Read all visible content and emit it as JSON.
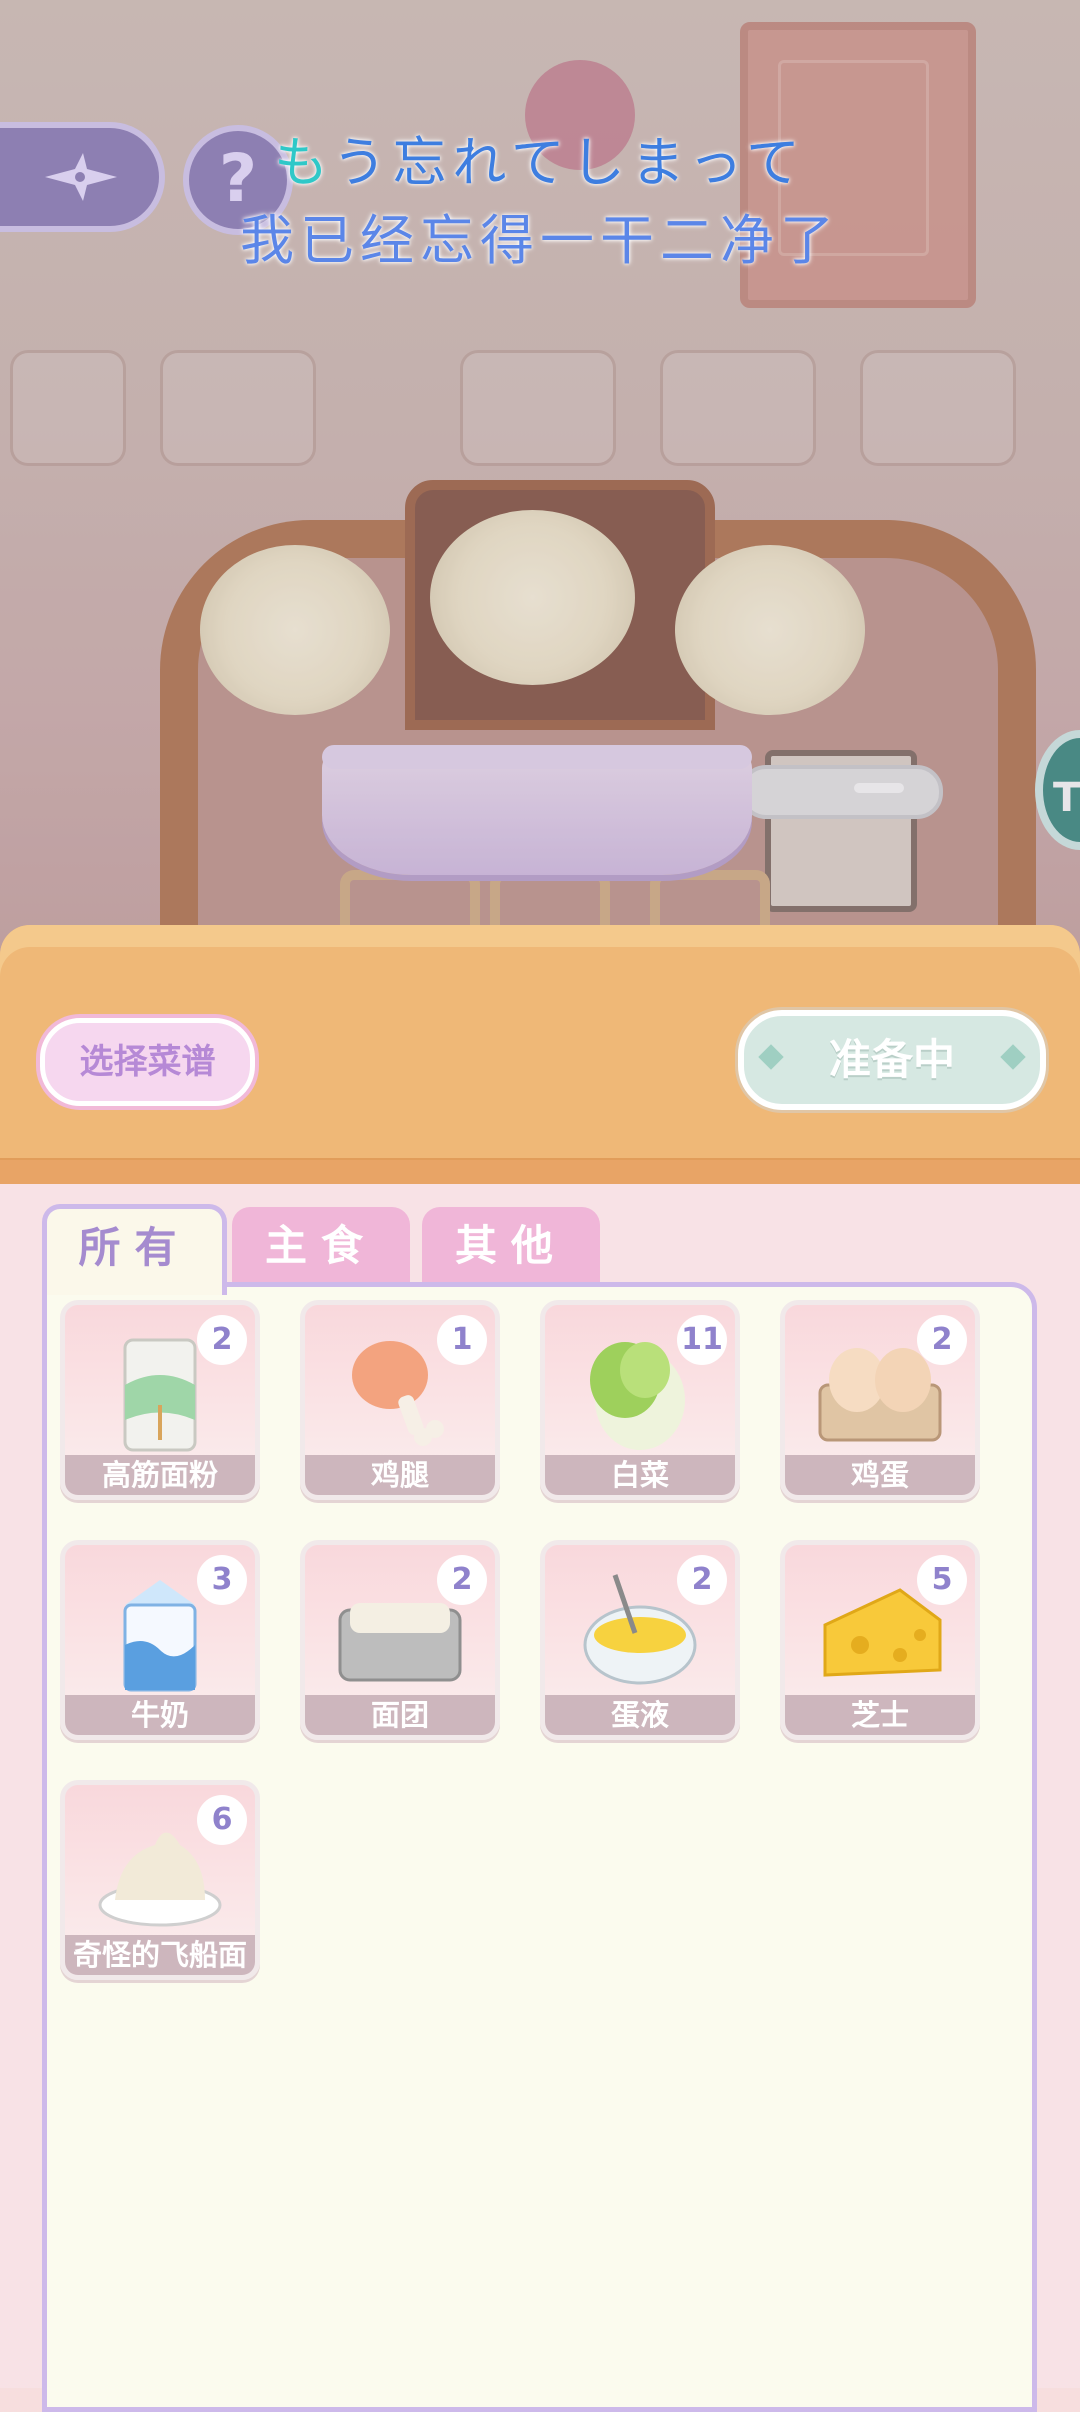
{
  "subtitle": {
    "jp_highlight": "も",
    "jp_highlight2": "う",
    "jp_rest": "忘れてしまって",
    "cn": "我已经忘得一干二净了"
  },
  "hud": {
    "back_icon": "compass-star-icon",
    "help_label": "?",
    "side_badge": "TO"
  },
  "counter": {
    "recipe_button": "选择菜谱",
    "status_button": "准备中"
  },
  "tabs": [
    {
      "label": "所有",
      "active": true
    },
    {
      "label": "主食",
      "active": false
    },
    {
      "label": "其他",
      "active": false
    }
  ],
  "inventory": [
    {
      "name": "高筋面粉",
      "count": "2",
      "icon": "flour-bag-icon"
    },
    {
      "name": "鸡腿",
      "count": "1",
      "icon": "chicken-leg-icon"
    },
    {
      "name": "白菜",
      "count": "11",
      "icon": "cabbage-icon"
    },
    {
      "name": "鸡蛋",
      "count": "2",
      "icon": "egg-carton-icon"
    },
    {
      "name": "牛奶",
      "count": "3",
      "icon": "milk-carton-icon"
    },
    {
      "name": "面团",
      "count": "2",
      "icon": "dough-tray-icon"
    },
    {
      "name": "蛋液",
      "count": "2",
      "icon": "egg-batter-bowl-icon"
    },
    {
      "name": "芝士",
      "count": "5",
      "icon": "cheese-icon"
    },
    {
      "name": "奇怪的飞船面",
      "count": "6",
      "icon": "strange-pasta-plate-icon"
    }
  ],
  "colors": {
    "accent_purple": "#a58bcf",
    "counter_orange": "#efb877",
    "tab_pink": "#f0b6d8"
  }
}
